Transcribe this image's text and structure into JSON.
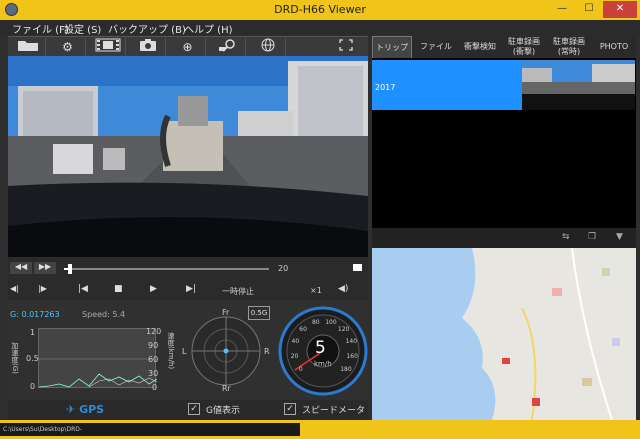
{
  "window": {
    "title": "DRD-H66 Viewer",
    "min": "—",
    "max": "☐",
    "close": "✕"
  },
  "menu": [
    "ファイル (F)",
    "設定 (S)",
    "バックアップ (B)",
    "ヘルプ (H)"
  ],
  "tabs": [
    {
      "label": "トリップ",
      "active": true
    },
    {
      "label": "ファイル",
      "active": false
    },
    {
      "label": "衝撃検知",
      "active": false
    },
    {
      "label": "駐車録画\n(衝撃)",
      "active": false
    },
    {
      "label": "駐車録画\n(常時)",
      "active": false
    },
    {
      "label": "PHOTO",
      "active": false
    }
  ],
  "trip_list": [
    {
      "label": "2017"
    }
  ],
  "playback": {
    "position_fraction": 0.03,
    "end_label": "20",
    "speed_label": "一時停止",
    "rate_label": "×1"
  },
  "sensor": {
    "g_value": "G: 0.017263",
    "speed": "Speed: 5.4",
    "left_axis": "加速度(G)",
    "left_ticks": [
      "1",
      "0.5",
      "0"
    ],
    "right_axis": "速度(km/h)",
    "right_ticks": [
      "120",
      "90",
      "60",
      "30",
      "0"
    ]
  },
  "compass": {
    "top": "Fr",
    "bottom": "Rr",
    "left": "L",
    "right": "R",
    "scale": "0.5G"
  },
  "speedometer": {
    "value": "5",
    "unit": "km/h",
    "ticks": [
      "0",
      "20",
      "40",
      "60",
      "80",
      "100",
      "120",
      "140",
      "160",
      "180"
    ]
  },
  "bottom": {
    "gps_label": "GPS",
    "g_display_label": "G値表示",
    "g_display_checked": true,
    "speedometer_label": "スピードメーター",
    "speedometer_checked": true
  },
  "status": {
    "path": "C:\\Users\\Su\\Desktop\\DRD-"
  },
  "colors": {
    "accent": "#f0c419",
    "selection": "#1e90ff",
    "gps": "#2e8bd8"
  }
}
